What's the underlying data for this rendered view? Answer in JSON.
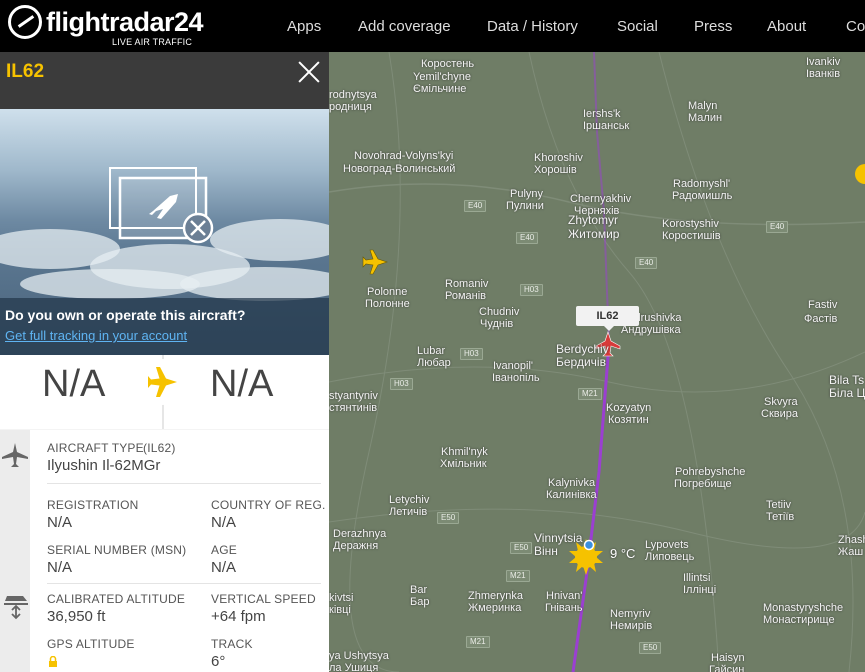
{
  "brand": {
    "name": "flightradar24",
    "tagline": "LIVE AIR TRAFFIC"
  },
  "nav": {
    "items": [
      "Apps",
      "Add coverage",
      "Data / History",
      "Social",
      "Press",
      "About",
      "Co"
    ]
  },
  "panel": {
    "title": "IL62",
    "close_icon": "close-icon",
    "photo": {
      "question": "Do you own or operate this aircraft?",
      "link": "Get full tracking in your account",
      "icon": "no-photo-icon"
    },
    "route": {
      "from": "N/A",
      "to": "N/A",
      "icon": "plane-icon",
      "accent": "#f6c200"
    },
    "aircraft": {
      "type_label": "AIRCRAFT TYPE",
      "type_code": "(IL62)",
      "type_value": "Ilyushin Il-62MGr",
      "registration_label": "REGISTRATION",
      "registration_value": "N/A",
      "country_label": "COUNTRY OF REG.",
      "country_value": "N/A",
      "serial_label": "SERIAL NUMBER (MSN)",
      "serial_value": "N/A",
      "age_label": "AGE",
      "age_value": "N/A"
    },
    "flight": {
      "cal_alt_label": "CALIBRATED ALTITUDE",
      "cal_alt_value": "36,950 ft",
      "vs_label": "VERTICAL SPEED",
      "vs_value": "+64 fpm",
      "gps_alt_label": "GPS ALTITUDE",
      "track_label": "TRACK",
      "track_value": "6°"
    }
  },
  "map": {
    "callsign_tag": "IL62",
    "weather": "9 °C",
    "track_color": "#9b3fd1",
    "cities": [
      [
        "Коростень",
        "Yemil'chyne",
        "Ємільчине",
        "Malyn",
        "Малин",
        "Iershs'k",
        "Іршанськ"
      ],
      [
        "Novohrad-Volyns'kyi",
        "Новоград-Волинський",
        "Khoroshiv",
        "Хорошів",
        "Radomyshl'",
        "Радомишль"
      ],
      [
        "Pulyny",
        "Пулини",
        "Chernyakhiv",
        "Черняхів",
        "Korostyshiv",
        "Коростишів"
      ],
      [
        "Zhytomyr",
        "Житомир",
        "Romaniv",
        "Романів",
        "Polonne",
        "Полонне",
        "Chudniv",
        "Чуднів"
      ],
      [
        "Andrushivka",
        "Андрушівка",
        "Fastiv",
        "Фастів",
        "Berdychiv",
        "Бердичів",
        "Lubar",
        "Любар"
      ],
      [
        "Ivanopil'",
        "Іванопіль",
        "Kozyatyn",
        "Козятин",
        "Skvyra",
        "Сквира",
        "Bila Ts",
        "Біла Ц"
      ],
      [
        "Khmil'nyk",
        "Хмільник",
        "Pohrebyshche",
        "Погребище",
        "Kalynivka",
        "Калинівка",
        "Letychiv",
        "Летичів"
      ],
      [
        "Derazhnya",
        "Деражня",
        "Tetiiv",
        "Тетіїв",
        "Vinnytsia",
        "Вінн",
        "Lypovets",
        "Липовець"
      ],
      [
        "Zhmerynka",
        "Жмеринка",
        "Hnivan'",
        "Гнівань",
        "Illintsi",
        "Іллінці",
        "Monastyryshche",
        "Монастирище"
      ],
      [
        "Nemyriv",
        "Немирів",
        "Haisyn",
        "Гайсин",
        "Ivankiv",
        "Іванків",
        "Bar",
        "Бар"
      ],
      [
        "Zhash",
        "Жаш",
        "styantyniv",
        "стянтинів",
        "rodnytsya",
        "родниця",
        "kivtsi",
        "ківці",
        "ya Ushytsya",
        "ла Ушиця"
      ]
    ],
    "roads": [
      "E40",
      "E40",
      "E40",
      "E40",
      "H03",
      "H03",
      "H03",
      "M21",
      "M21",
      "M21",
      "E50",
      "E50",
      "E50"
    ]
  }
}
